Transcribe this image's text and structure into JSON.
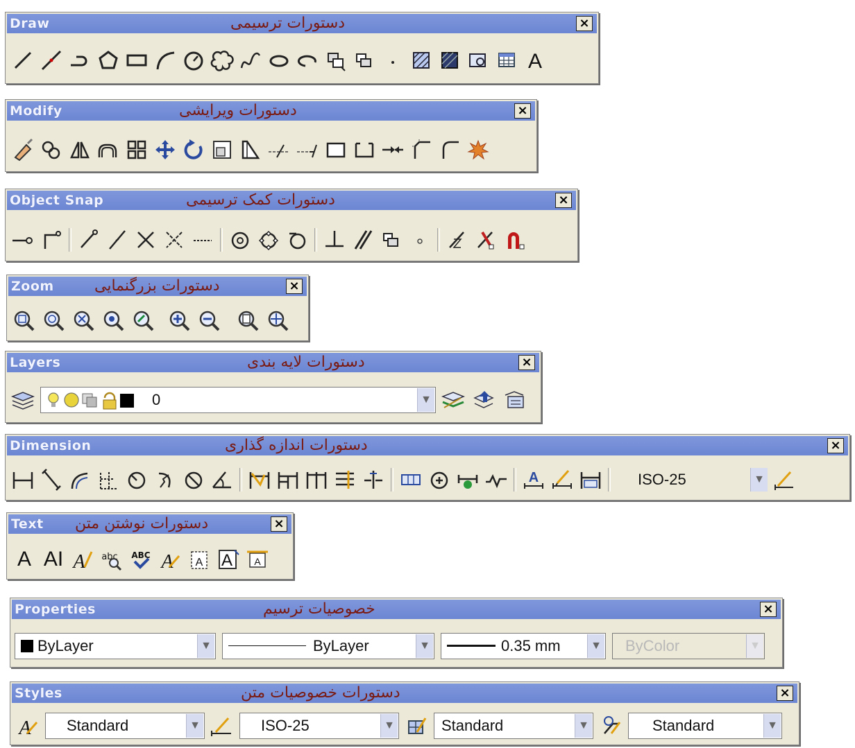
{
  "toolbars": {
    "draw": {
      "title": "Draw",
      "title_fa": "دستورات ترسیمی",
      "close": "×"
    },
    "modify": {
      "title": "Modify",
      "title_fa": "دستورات ویرایشی",
      "close": "×"
    },
    "osnap": {
      "title": "Object Snap",
      "title_fa": "دستورات کمک ترسیمی",
      "close": "×"
    },
    "zoom": {
      "title": "Zoom",
      "title_fa": "دستورات بزرگنمایی",
      "close": "×"
    },
    "layers": {
      "title": "Layers",
      "title_fa": "دستورات لایه بندی",
      "close": "×",
      "current_layer": "0"
    },
    "dimension": {
      "title": "Dimension",
      "title_fa": "دستورات اندازه گذاری",
      "close": "×",
      "dimstyle": "ISO-25"
    },
    "text": {
      "title": "Text",
      "title_fa": "دستورات نوشتن متن",
      "close": "×",
      "text_icon_a": "A",
      "text_icon_ai": "AI"
    },
    "properties": {
      "title": "Properties",
      "title_fa": "خصوصیات ترسیم",
      "close": "×",
      "color": "ByLayer",
      "linetype": "ByLayer",
      "lineweight": "0.35 mm",
      "plotstyle": "ByColor"
    },
    "styles": {
      "title": "Styles",
      "title_fa": "دستورات خصوصیات متن",
      "close": "×",
      "text_style": "Standard",
      "dim_style": "ISO-25",
      "table_style": "Standard",
      "mleader_style": "Standard"
    }
  },
  "draw_text_icon": "A",
  "icons": {
    "draw": [
      "line-icon",
      "construction-line-icon",
      "polyline-icon",
      "polygon-icon",
      "rectangle-icon",
      "arc-icon",
      "circle-icon",
      "revision-cloud-icon",
      "spline-icon",
      "ellipse-icon",
      "ellipse-arc-icon",
      "insert-block-icon",
      "make-block-icon",
      "point-icon",
      "hatch-icon",
      "gradient-icon",
      "region-icon",
      "table-icon",
      "multiline-text-icon"
    ],
    "modify": [
      "erase-icon",
      "copy-icon",
      "mirror-icon",
      "offset-icon",
      "array-icon",
      "move-icon",
      "rotate-icon",
      "scale-icon",
      "stretch-icon",
      "trim-icon",
      "extend-icon",
      "break-at-point-icon",
      "break-icon",
      "join-icon",
      "chamfer-icon",
      "fillet-icon",
      "explode-icon"
    ],
    "osnap": [
      "temporary-track-icon",
      "snap-from-icon",
      "snap-endpoint-icon",
      "snap-midpoint-icon",
      "snap-intersection-icon",
      "snap-apparent-intersection-icon",
      "snap-extension-icon",
      "snap-center-icon",
      "snap-quadrant-icon",
      "snap-tangent-icon",
      "snap-perpendicular-icon",
      "snap-parallel-icon",
      "snap-insert-icon",
      "snap-node-icon",
      "snap-nearest-icon",
      "snap-none-icon",
      "osnap-settings-icon"
    ],
    "zoom": [
      "zoom-window-icon",
      "zoom-dynamic-icon",
      "zoom-scale-icon",
      "zoom-center-icon",
      "zoom-object-icon",
      "zoom-in-icon",
      "zoom-out-icon",
      "zoom-all-icon",
      "zoom-extents-icon"
    ]
  },
  "colors": {
    "titlebar": "#6c86d3",
    "toolbar_bg": "#ece9d8",
    "persian_title": "#7a1a10"
  }
}
